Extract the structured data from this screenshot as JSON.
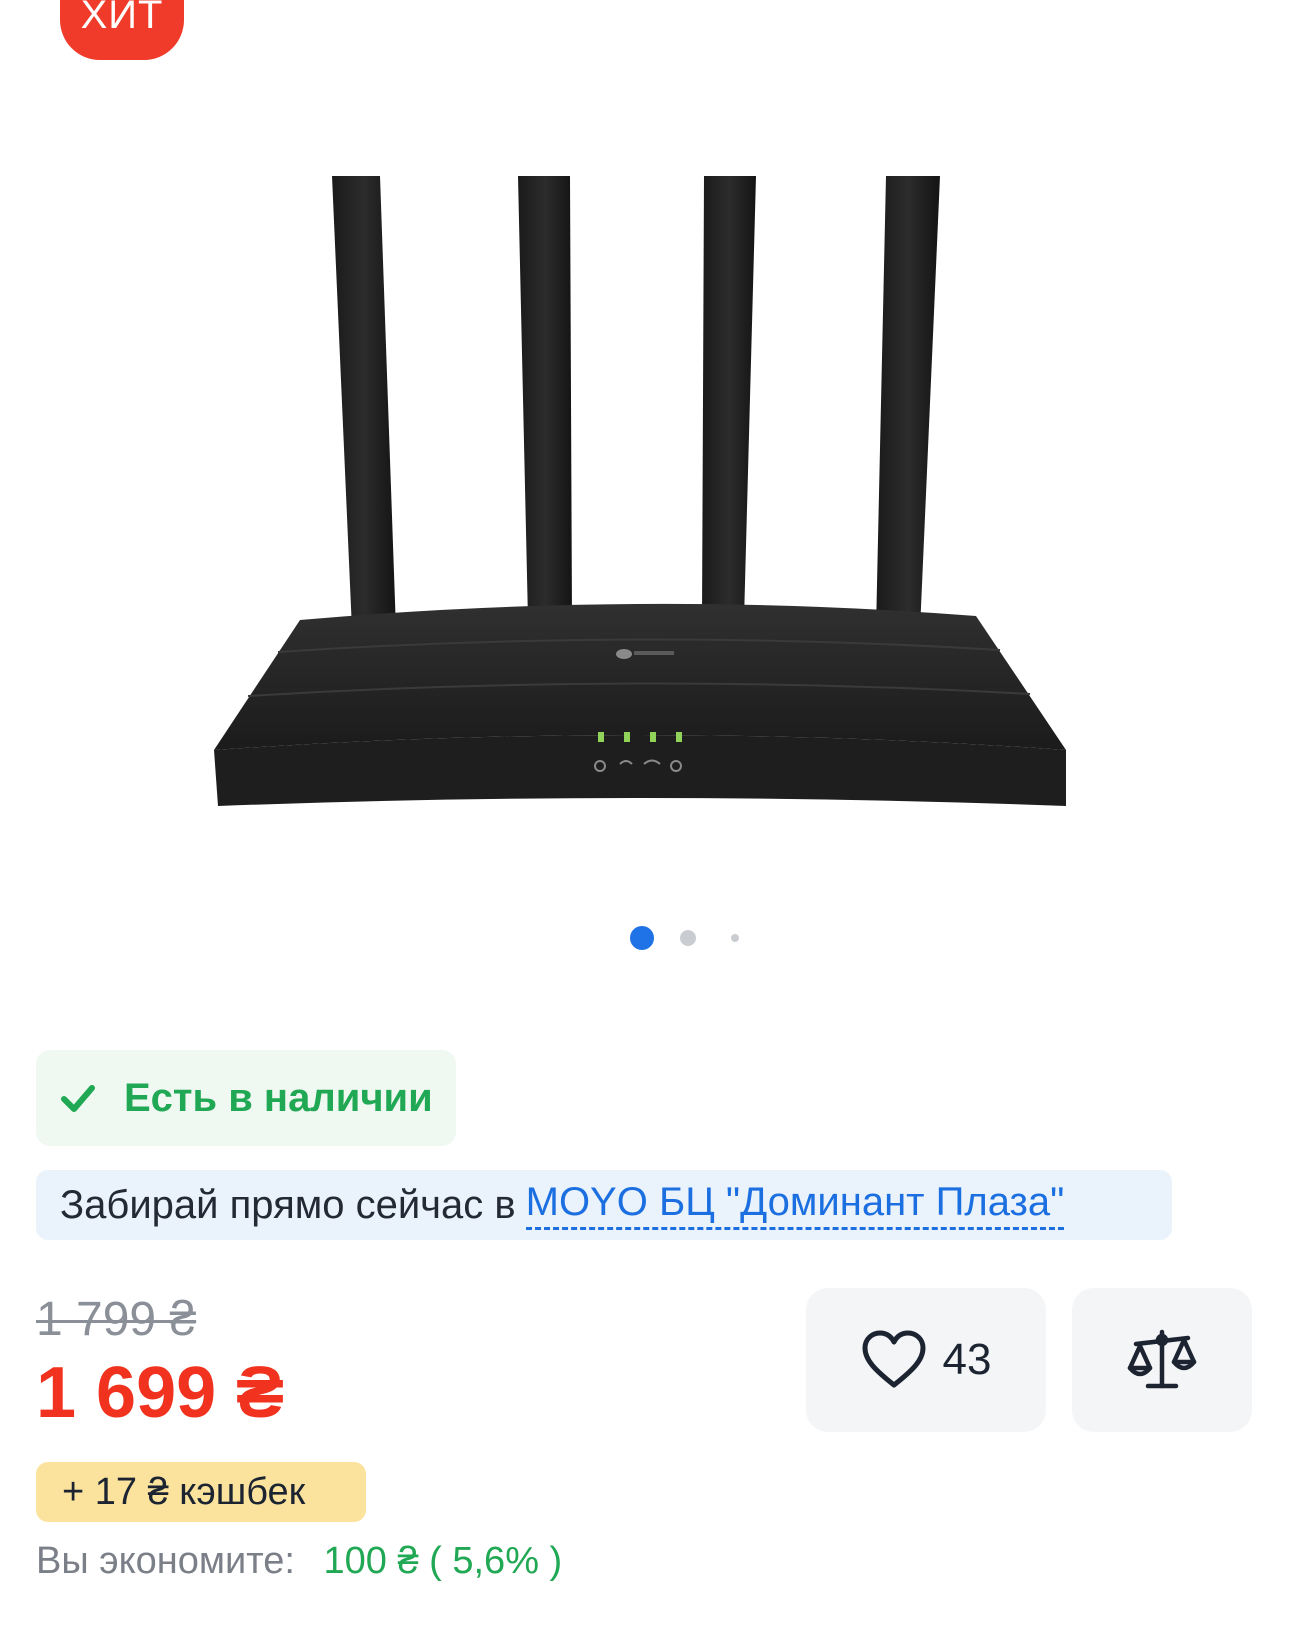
{
  "badge": {
    "label": "ХИТ"
  },
  "gallery": {
    "image": "tp-link-router-four-antennas",
    "slides": 3,
    "active_slide": 1
  },
  "availability": {
    "icon": "checkmark-icon",
    "label": "Есть в наличии"
  },
  "pickup": {
    "prefix": "Забирай прямо сейчас в",
    "store": "MOYO БЦ \"Доминант Плаза\""
  },
  "price": {
    "old": "1 799 ₴",
    "current": "1 699 ₴"
  },
  "wishlist": {
    "icon": "heart-icon",
    "count": "43"
  },
  "compare": {
    "icon": "scales-icon"
  },
  "cashback": {
    "label": "+ 17 ₴ кэшбек"
  },
  "saving": {
    "label": "Вы экономите:",
    "value": "100 ₴ ( 5,6% )"
  },
  "colors": {
    "badge": "#f03b2a",
    "price": "#f0321f",
    "green": "#20a854",
    "link": "#1c6fe0",
    "dot_active": "#1f73e6"
  }
}
